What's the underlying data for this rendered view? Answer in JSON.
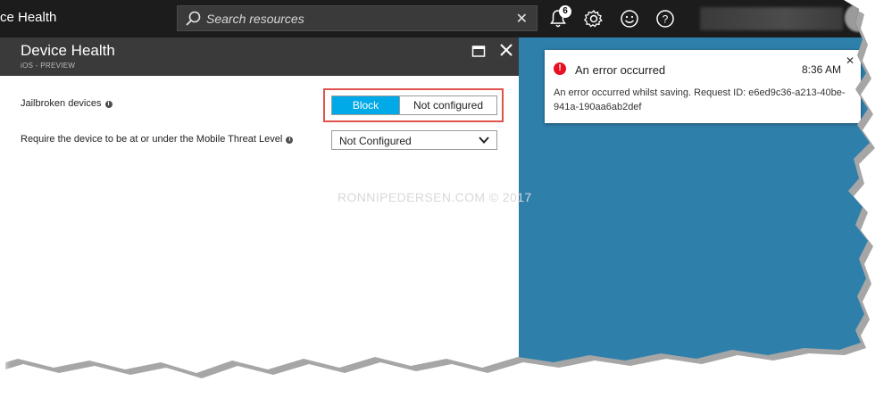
{
  "topbar": {
    "title": "ce Health",
    "search_placeholder": "Search resources",
    "clear_symbol": "✕",
    "notifications_count": "6",
    "icons": [
      "search-icon",
      "bell-icon",
      "gear-icon",
      "smiley-icon",
      "help-icon"
    ]
  },
  "blade": {
    "title": "Device Health",
    "subtitle": "iOS - PREVIEW",
    "jailbroken_label": "Jailbroken devices",
    "info_symbol": "i",
    "toggle": {
      "options": [
        "Block",
        "Not configured"
      ],
      "selected": "Block"
    },
    "threat_label": "Require the device to be at or under the Mobile Threat Level",
    "threat_value": "Not Configured"
  },
  "toast": {
    "title": "An error occurred",
    "time": "8:36 AM",
    "message": "An error occurred whilst saving. Request ID: e6ed9c36-a213-40be-941a-190aa6ab2def",
    "error_symbol": "!",
    "close_symbol": "✕"
  },
  "watermark": "RONNIPEDERSEN.COM © 2017",
  "colors": {
    "topbar": "#1c1c1c",
    "blade_header": "#3a3a3a",
    "accent": "#00a9e7",
    "background": "#2f7fab",
    "error": "#e81123",
    "highlight": "#e0524a"
  }
}
